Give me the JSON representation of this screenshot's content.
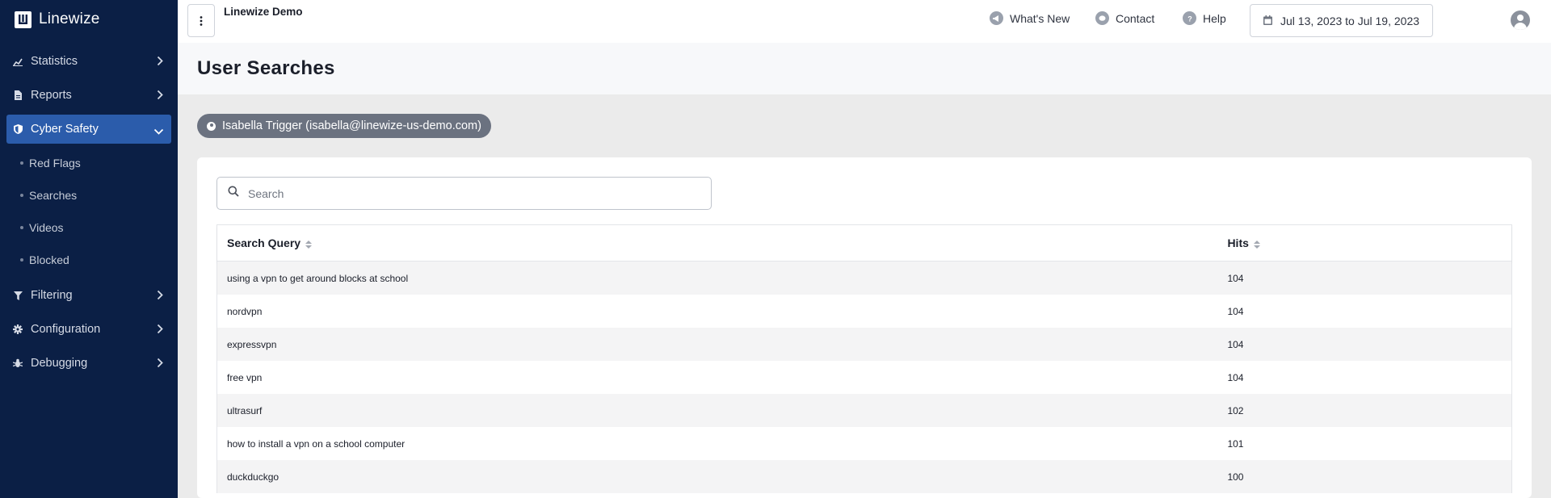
{
  "brand": {
    "name": "Linewize"
  },
  "sidebar": {
    "items": [
      {
        "label": "Statistics",
        "icon": "chart-icon"
      },
      {
        "label": "Reports",
        "icon": "document-icon"
      },
      {
        "label": "Cyber Safety",
        "icon": "shield-icon",
        "active": true,
        "children": [
          {
            "label": "Red Flags"
          },
          {
            "label": "Searches"
          },
          {
            "label": "Videos"
          },
          {
            "label": "Blocked"
          }
        ]
      },
      {
        "label": "Filtering",
        "icon": "filter-icon"
      },
      {
        "label": "Configuration",
        "icon": "gear-icon"
      },
      {
        "label": "Debugging",
        "icon": "bug-icon"
      }
    ]
  },
  "topbar": {
    "org_name": "Linewize Demo",
    "whats_new": "What's New",
    "contact": "Contact",
    "help": "Help",
    "date_range": "Jul 13, 2023 to Jul 19, 2023"
  },
  "page": {
    "title": "User Searches",
    "user_chip": "Isabella Trigger (isabella@linewize-us-demo.com)"
  },
  "search": {
    "placeholder": "Search",
    "value": ""
  },
  "table": {
    "columns": [
      "Search Query",
      "Hits"
    ],
    "rows": [
      {
        "query": "using a vpn to get around blocks at school",
        "hits": "104"
      },
      {
        "query": "nordvpn",
        "hits": "104"
      },
      {
        "query": "expressvpn",
        "hits": "104"
      },
      {
        "query": "free vpn",
        "hits": "104"
      },
      {
        "query": "ultrasurf",
        "hits": "102"
      },
      {
        "query": "how to install a vpn on a school computer",
        "hits": "101"
      },
      {
        "query": "duckduckgo",
        "hits": "100"
      }
    ]
  },
  "colors": {
    "sidebar_bg": "#0b1f45",
    "active_item": "#2b5cab",
    "chip_bg": "#6b7280"
  }
}
